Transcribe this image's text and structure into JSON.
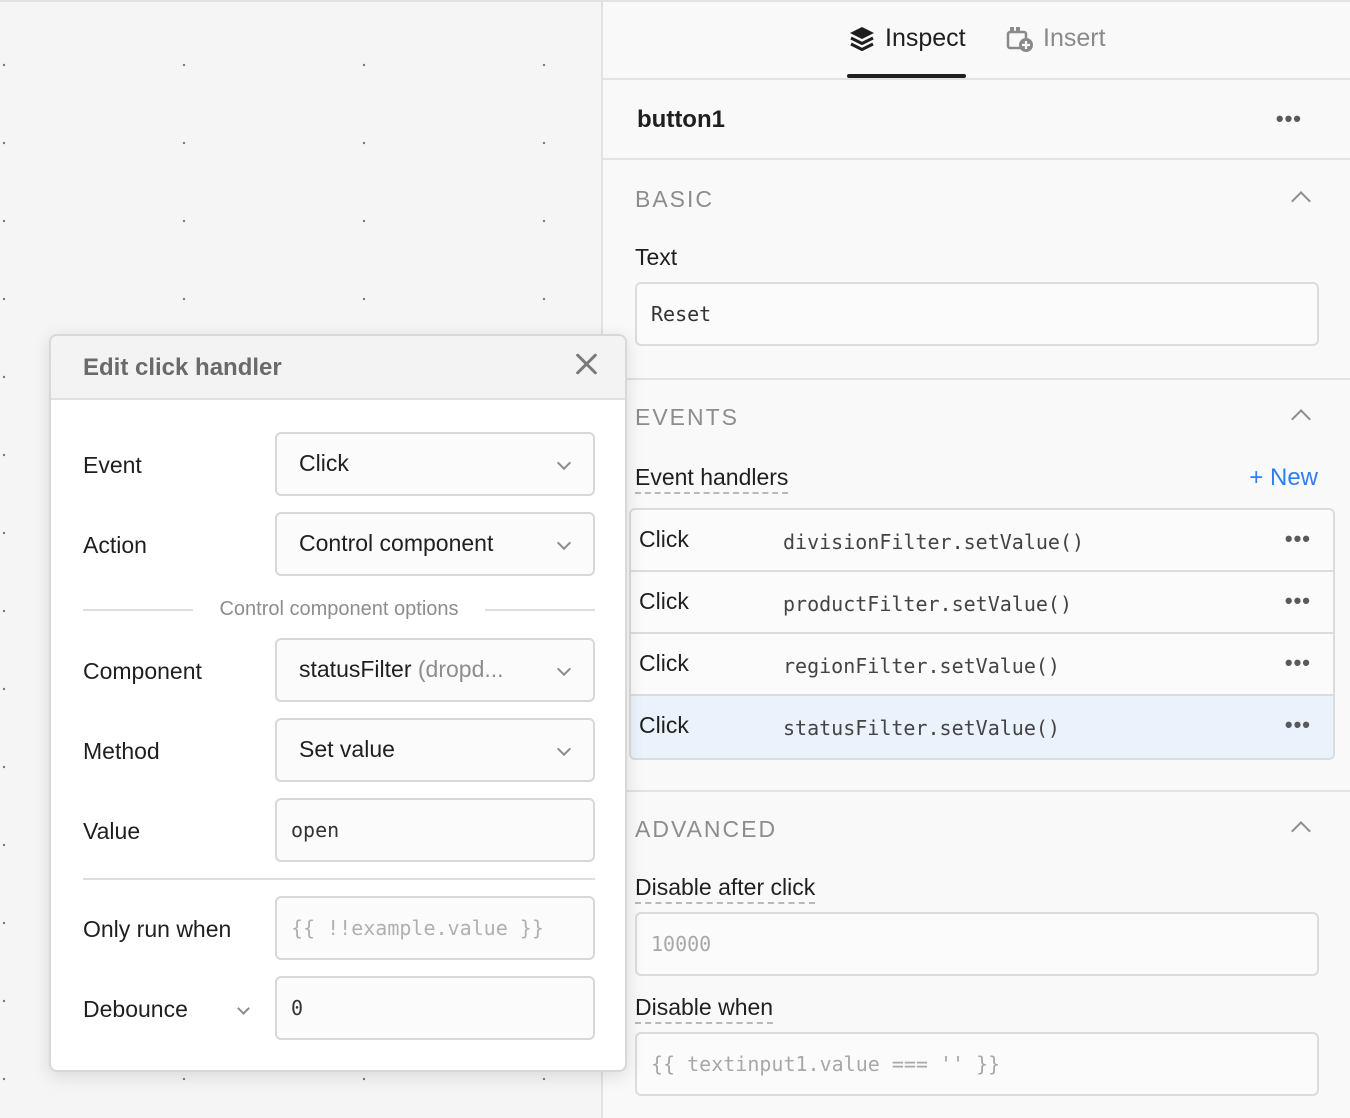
{
  "tabs": [
    {
      "label": "Inspect",
      "icon": "layers-icon",
      "active": true
    },
    {
      "label": "Insert",
      "icon": "insert-component-icon",
      "active": false
    }
  ],
  "component": {
    "name": "button1"
  },
  "basic": {
    "title": "BASIC",
    "text_label": "Text",
    "text_value": "Reset"
  },
  "events": {
    "title": "EVENTS",
    "handlers_label": "Event handlers",
    "new_label": "+ New",
    "handlers": [
      {
        "event": "Click",
        "method": "divisionFilter.setValue()"
      },
      {
        "event": "Click",
        "method": "productFilter.setValue()"
      },
      {
        "event": "Click",
        "method": "regionFilter.setValue()"
      },
      {
        "event": "Click",
        "method": "statusFilter.setValue()"
      }
    ]
  },
  "advanced": {
    "title": "ADVANCED",
    "disable_after_click_label": "Disable after click",
    "disable_after_click_placeholder": "10000",
    "disable_when_label": "Disable when",
    "disable_when_placeholder": "{{ textinput1.value === '' }}"
  },
  "modal": {
    "title": "Edit click handler",
    "event_label": "Event",
    "event_value": "Click",
    "action_label": "Action",
    "action_value": "Control component",
    "options_divider": "Control component options",
    "component_label": "Component",
    "component_value": "statusFilter",
    "component_type": "(dropd...",
    "method_label": "Method",
    "method_value": "Set value",
    "value_label": "Value",
    "value_value": "open",
    "only_run_label": "Only run when",
    "only_run_placeholder": "{{ !!example.value }}",
    "debounce_label": "Debounce",
    "debounce_value": "0"
  },
  "colors": {
    "accent": "#2f7ff0",
    "selected_row": "#eaf2fc"
  }
}
